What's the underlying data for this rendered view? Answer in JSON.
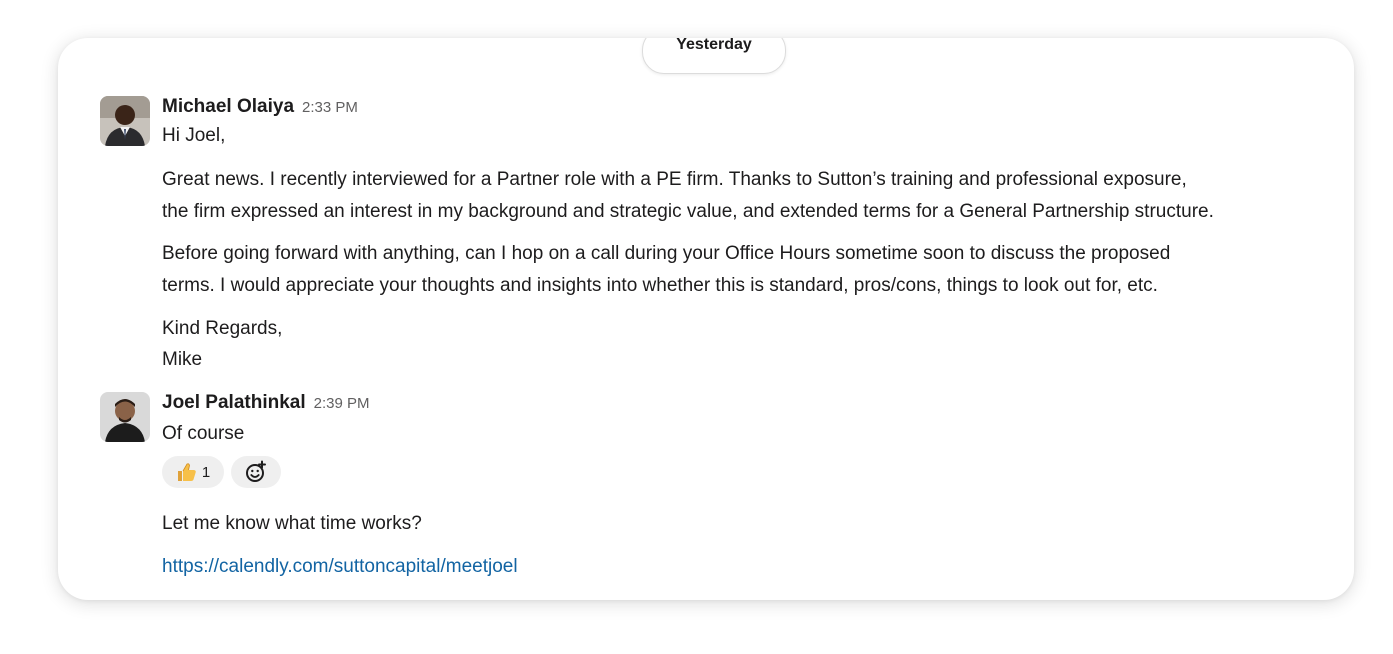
{
  "date_divider": {
    "label": "Yesterday"
  },
  "messages": [
    {
      "author": "Michael Olaiya",
      "time": "2:33 PM",
      "lines": [
        "Hi Joel,",
        "Great news. I recently interviewed for a Partner role with a PE firm. Thanks to Sutton’s training and professional exposure,",
        "the firm expressed an interest in my background and strategic value, and extended terms for a General Partnership structure.",
        "Before going forward with anything, can I hop on a call during your Office Hours sometime soon to discuss the proposed",
        "terms. I would appreciate your thoughts and insights into whether this is standard, pros/cons, things to look out for, etc.",
        "Kind Regards,",
        "Mike"
      ]
    },
    {
      "author": "Joel Palathinkal",
      "time": "2:39 PM",
      "lines": [
        "Of course"
      ],
      "reactions": [
        {
          "emoji": "thumbs-up-icon",
          "count": "1"
        },
        {
          "emoji": "add-reaction-icon"
        }
      ]
    },
    {
      "lines": [
        "Let me know what time works?"
      ],
      "link": "https://calendly.com/suttoncapital/meetjoel"
    }
  ],
  "colors": {
    "link": "#1264a3",
    "reaction_bg": "#efefef",
    "text": "#1d1c1d",
    "timestamp": "#616061"
  }
}
